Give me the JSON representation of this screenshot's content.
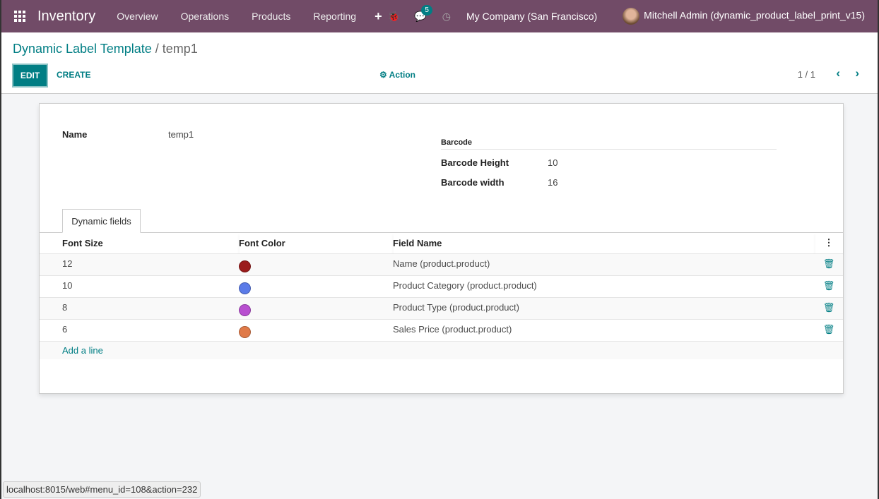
{
  "nav": {
    "app": "Inventory",
    "menus": [
      "Overview",
      "Operations",
      "Products",
      "Reporting"
    ],
    "plus": "+",
    "chat_badge": "5",
    "company": "My Company (San Francisco)",
    "user": "Mitchell Admin (dynamic_product_label_print_v15)"
  },
  "cp": {
    "breadcrumb_parent": "Dynamic Label Template",
    "breadcrumb_sep": " / ",
    "breadcrumb_current": "temp1",
    "edit": "EDIT",
    "create": "CREATE",
    "action": "Action",
    "pager": "1 / 1"
  },
  "form": {
    "name_label": "Name",
    "name_value": "temp1",
    "barcode_section": "Barcode",
    "barcode_height_label": "Barcode Height",
    "barcode_height": "10",
    "barcode_width_label": "Barcode width",
    "barcode_width": "16"
  },
  "tab": "Dynamic fields",
  "table": {
    "headers": [
      "Font Size",
      "Font Color",
      "Field Name"
    ],
    "rows": [
      {
        "size": "12",
        "color": "#9b1b1b",
        "field": "Name (product.product)"
      },
      {
        "size": "10",
        "color": "#5b7be8",
        "field": "Product Category (product.product)"
      },
      {
        "size": "8",
        "color": "#b84fd0",
        "field": "Product Type (product.product)"
      },
      {
        "size": "6",
        "color": "#e07a48",
        "field": "Sales Price (product.product)"
      }
    ],
    "add_line": "Add a line"
  },
  "status_url": "localhost:8015/web#menu_id=108&action=232"
}
